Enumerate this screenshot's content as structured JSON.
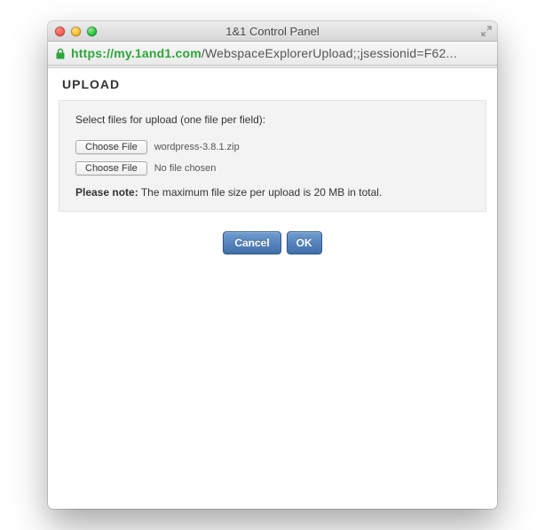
{
  "window": {
    "title": "1&1 Control Panel"
  },
  "url": {
    "scheme": "https",
    "schemesep": "://",
    "host": "my.1and1.com",
    "path": "/WebspaceExplorerUpload;;jsessionid=F62",
    "ellipsis": "..."
  },
  "page": {
    "header": "UPLOAD",
    "instructions": "Select files for upload (one file per field):",
    "file_inputs": [
      {
        "button_label": "Choose File",
        "filename": "wordpress-3.8.1.zip"
      },
      {
        "button_label": "Choose File",
        "filename": "No file chosen"
      }
    ],
    "note_bold": "Please note:",
    "note_text": " The maximum file size per upload is 20 MB in total.",
    "cancel_label": "Cancel",
    "ok_label": "OK"
  }
}
